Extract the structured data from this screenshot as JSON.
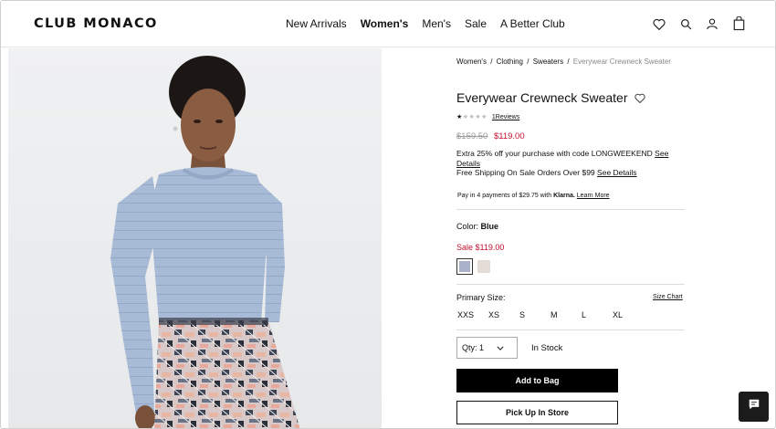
{
  "brand": {
    "logo_text": "CLUB MONACO"
  },
  "nav": {
    "items": [
      {
        "label": "New Arrivals"
      },
      {
        "label": "Women's"
      },
      {
        "label": "Men's"
      },
      {
        "label": "Sale"
      },
      {
        "label": "A Better Club"
      }
    ]
  },
  "header_icons": [
    "wishlist-heart-icon",
    "search-icon",
    "account-icon",
    "shopping-bag-icon"
  ],
  "breadcrumb": {
    "items": [
      "Women's",
      "Clothing",
      "Sweaters"
    ],
    "current": "Everywear Crewneck Sweater",
    "separator": "/"
  },
  "product": {
    "title": "Everywear Crewneck Sweater",
    "rating": {
      "stars": 1,
      "max": 5,
      "reviews_label": "1Reviews"
    },
    "price_was": "$159.50",
    "price_now": "$119.00",
    "promo_code_text": "Extra 25% off your purchase with code LONGWEEKEND",
    "promo_code_link": "See Details",
    "shipping_text": "Free Shipping On Sale Orders Over $99",
    "shipping_link": "See Details",
    "klarna_text_pre": "Pay in 4 payments of $29.75 with",
    "klarna_brand": "Klarna.",
    "klarna_link": "Learn More",
    "color_label": "Color:",
    "color_value": "Blue",
    "sale_price": "Sale $119.00",
    "swatches": [
      {
        "name": "Blue",
        "color": "#a9b1c8",
        "selected": true
      },
      {
        "name": "Oatmeal",
        "color": "#e4dcd6",
        "selected": false
      }
    ],
    "size_label": "Primary Size:",
    "size_chart_label": "Size Chart",
    "sizes": [
      "XXS",
      "XS",
      "S",
      "M",
      "L",
      "XL"
    ],
    "qty_label": "Qty: 1",
    "stock_status": "In Stock",
    "add_to_bag_label": "Add to Bag",
    "pickup_label": "Pick Up In Store"
  },
  "colors": {
    "sale_red": "#c8102e",
    "primary_button_bg": "#000000",
    "sweater_blue": "#a9bcd8"
  },
  "chat": {
    "icon": "chat-icon"
  }
}
